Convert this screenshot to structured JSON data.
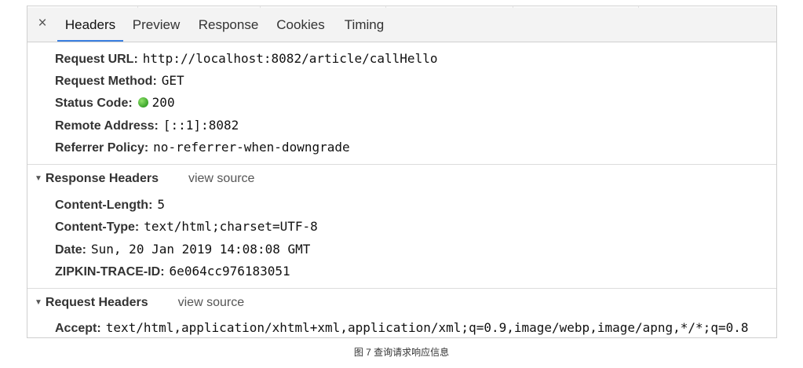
{
  "tabs": {
    "close_glyph": "×",
    "items": [
      {
        "label": "Headers",
        "active": true
      },
      {
        "label": "Preview",
        "active": false
      },
      {
        "label": "Response",
        "active": false
      },
      {
        "label": "Cookies",
        "active": false
      },
      {
        "label": "Timing",
        "active": false
      }
    ]
  },
  "general": {
    "request_url": {
      "key": "Request URL:",
      "value": "http://localhost:8082/article/callHello"
    },
    "request_method": {
      "key": "Request Method:",
      "value": "GET"
    },
    "status_code": {
      "key": "Status Code:",
      "value": "200",
      "dot_color": "#3aa32a"
    },
    "remote_address": {
      "key": "Remote Address:",
      "value": "[::1]:8082"
    },
    "referrer_policy": {
      "key": "Referrer Policy:",
      "value": "no-referrer-when-downgrade"
    }
  },
  "response_headers": {
    "title": "Response Headers",
    "view_source": "view source",
    "items": [
      {
        "key": "Content-Length:",
        "value": "5"
      },
      {
        "key": "Content-Type:",
        "value": "text/html;charset=UTF-8"
      },
      {
        "key": "Date:",
        "value": "Sun, 20 Jan 2019 14:08:08 GMT"
      },
      {
        "key": "ZIPKIN-TRACE-ID:",
        "value": "6e064cc976183051"
      }
    ]
  },
  "request_headers": {
    "title": "Request Headers",
    "view_source": "view source",
    "items": [
      {
        "key": "Accept:",
        "value": "text/html,application/xhtml+xml,application/xml;q=0.9,image/webp,image/apng,*/*;q=0.8"
      }
    ]
  },
  "caption": "图 7  查询请求响应信息",
  "colors": {
    "active_tab_underline": "#3a7fe0",
    "tabbar_bg": "#f3f3f3"
  }
}
